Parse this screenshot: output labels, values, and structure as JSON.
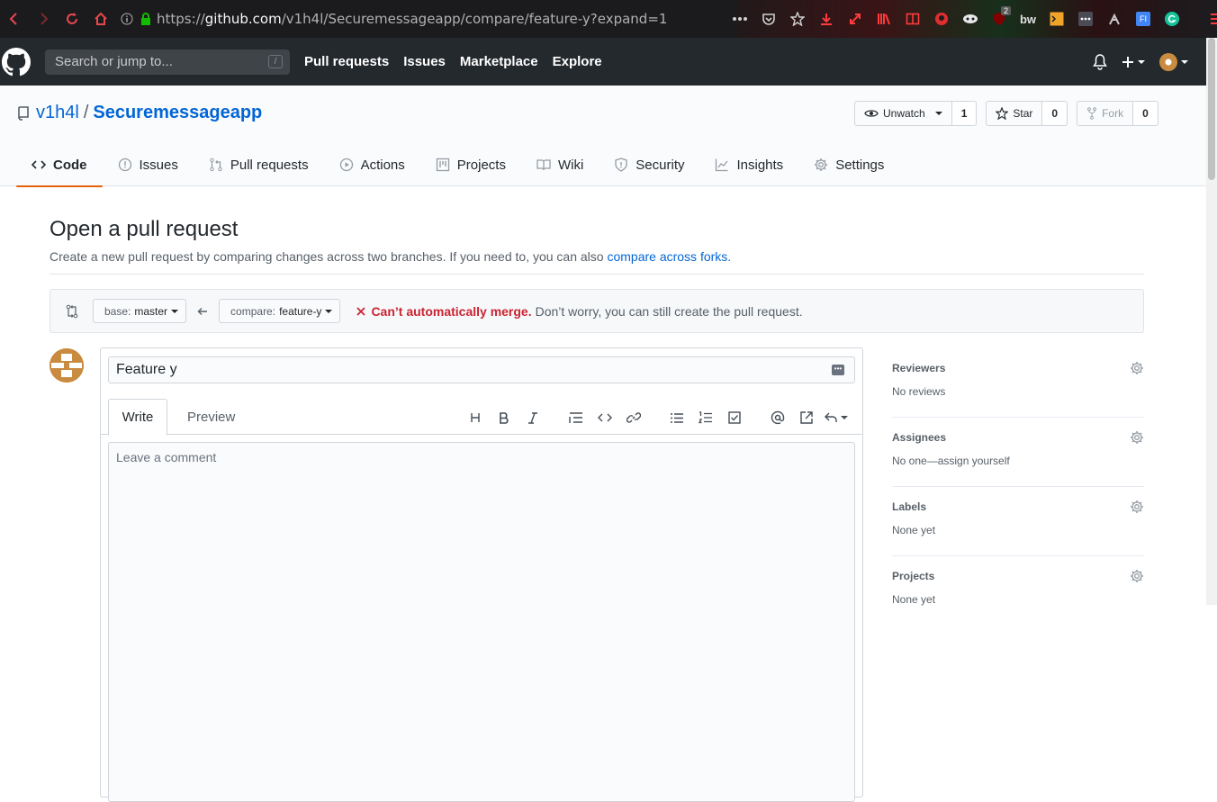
{
  "browser": {
    "url_prefix": "https://",
    "url_host": "github.com",
    "url_path": "/v1h4l/Securemessageapp/compare/feature-y?expand=1",
    "ext_badge": "2",
    "ext_bw": "bw",
    "ext_fi": "FI"
  },
  "header": {
    "search_placeholder": "Search or jump to...",
    "slash": "/",
    "nav": [
      "Pull requests",
      "Issues",
      "Marketplace",
      "Explore"
    ]
  },
  "repo": {
    "owner": "v1h4l",
    "separator": "/",
    "name": "Securemessageapp",
    "unwatch_label": "Unwatch",
    "watch_count": "1",
    "star_label": "Star",
    "star_count": "0",
    "fork_label": "Fork",
    "fork_count": "0"
  },
  "tabs": [
    "Code",
    "Issues",
    "Pull requests",
    "Actions",
    "Projects",
    "Wiki",
    "Security",
    "Insights",
    "Settings"
  ],
  "page": {
    "title": "Open a pull request",
    "subtitle": "Create a new pull request by comparing changes across two branches. If you need to, you can also ",
    "subtitle_link": "compare across forks."
  },
  "range": {
    "base_label": "base: ",
    "base_value": "master",
    "compare_label": "compare: ",
    "compare_value": "feature-y",
    "merge_status": "Can’t automatically merge.",
    "merge_message": "Don’t worry, you can still create the pull request."
  },
  "form": {
    "title_value": "Feature y",
    "write_tab": "Write",
    "preview_tab": "Preview",
    "comment_placeholder": "Leave a comment"
  },
  "sidebar": [
    {
      "heading": "Reviewers",
      "value": "No reviews"
    },
    {
      "heading": "Assignees",
      "value": "No one—assign yourself"
    },
    {
      "heading": "Labels",
      "value": "None yet"
    },
    {
      "heading": "Projects",
      "value": "None yet"
    }
  ],
  "colors": {
    "header_bg": "#24292e",
    "link": "#0366d6",
    "error": "#cb2431",
    "tab_accent": "#e36209"
  }
}
